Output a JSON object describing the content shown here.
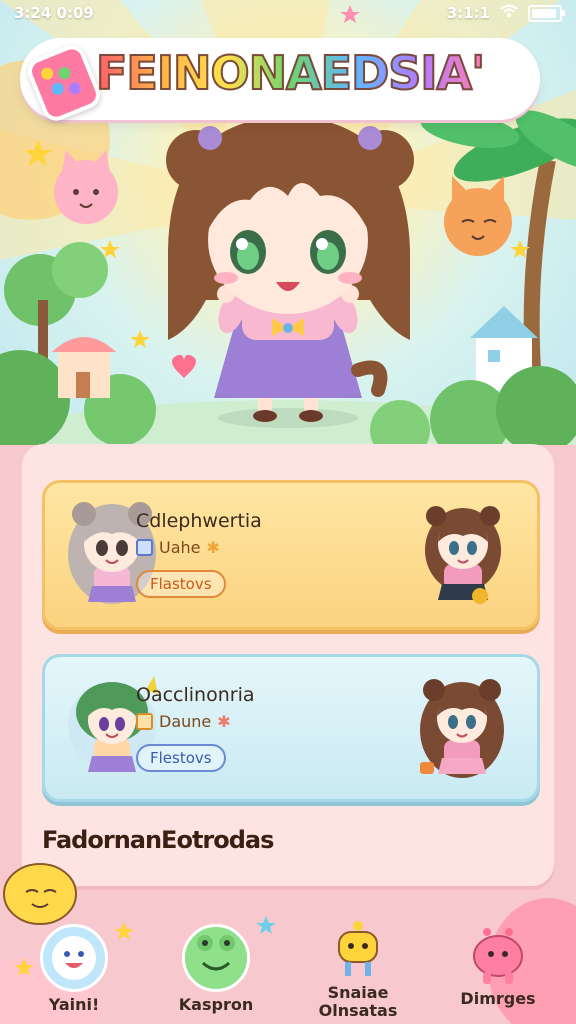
{
  "status_bar": {
    "time": "3:24 0:09",
    "signal": "3:1:1"
  },
  "header": {
    "title": "FEINONAEDSIA'"
  },
  "cards": [
    {
      "title": "Cdlephwertia",
      "sub_label": "Uahe",
      "button_label": "Flastovs",
      "accent": "#f4c165"
    },
    {
      "title": "Oacclinonria",
      "sub_label": "Daune",
      "button_label": "Flestovs",
      "accent": "#a6d9e8"
    }
  ],
  "section": {
    "title": "FadornanEotrodas"
  },
  "nav": [
    {
      "label": "Yaini!",
      "icon": "smile-face-icon"
    },
    {
      "label": "Kaspron",
      "icon": "frog-face-icon"
    },
    {
      "label": "Snaiae\nOlnsatas",
      "icon": "yellow-bot-icon"
    },
    {
      "label": "Dimrges",
      "icon": "pink-creature-icon"
    }
  ],
  "colors": {
    "panel": "#fde4e2",
    "gold_card": "#fbd380",
    "blue_card": "#c9eaf2",
    "text": "#3b2a1f"
  }
}
